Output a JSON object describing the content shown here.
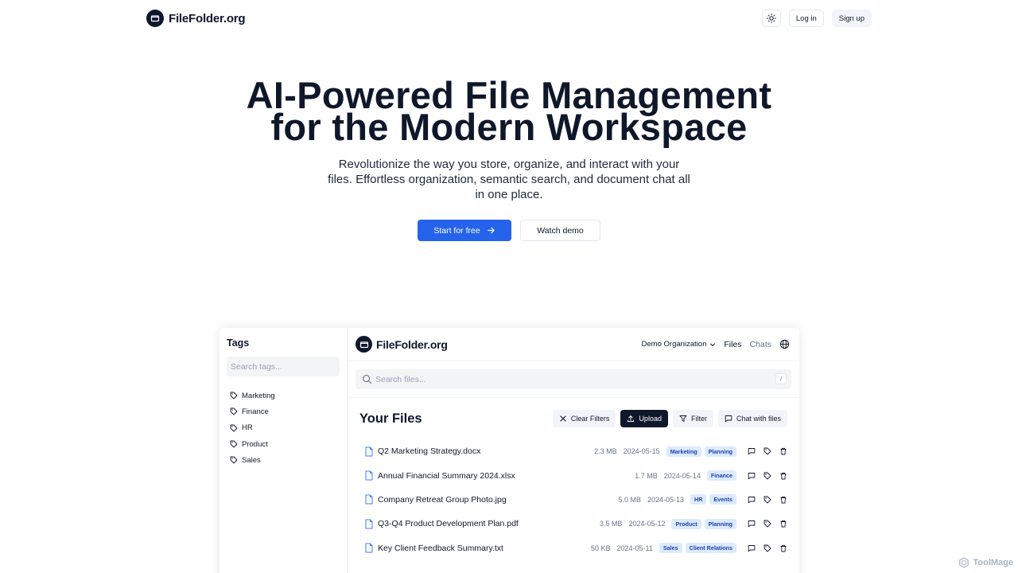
{
  "nav": {
    "brand": "FileFolder.org",
    "login": "Log in",
    "signup": "Sign up"
  },
  "hero": {
    "title_line1": "AI-Powered File Management",
    "title_line2": "for the Modern Workspace",
    "subtitle": "Revolutionize the way you store, organize, and interact with your files. Effortless organization, semantic search, and document chat all in one place.",
    "cta_primary": "Start for free",
    "cta_secondary": "Watch demo"
  },
  "demo": {
    "sidebar": {
      "title": "Tags",
      "search_placeholder": "Search tags...",
      "tags": [
        "Marketing",
        "Finance",
        "HR",
        "Product",
        "Sales"
      ]
    },
    "header": {
      "brand": "FileFolder.org",
      "org": "Demo Organization",
      "files_link": "Files",
      "chats_link": "Chats"
    },
    "search": {
      "placeholder": "Search files...",
      "shortcut": "/"
    },
    "files": {
      "title": "Your Files",
      "toolbar": {
        "clear_filters": "Clear Filters",
        "upload": "Upload",
        "filter": "Filter",
        "chat": "Chat with files"
      },
      "rows": [
        {
          "name": "Q2 Marketing Strategy.docx",
          "size": "2.3 MB",
          "date": "2024-05-15",
          "tags": [
            "Marketing",
            "Planning"
          ]
        },
        {
          "name": "Annual Financial Summary 2024.xlsx",
          "size": "1.7 MB",
          "date": "2024-05-14",
          "tags": [
            "Finance"
          ]
        },
        {
          "name": "Company Retreat Group Photo.jpg",
          "size": "5.0 MB",
          "date": "2024-05-13",
          "tags": [
            "HR",
            "Events"
          ]
        },
        {
          "name": "Q3-Q4 Product Development Plan.pdf",
          "size": "3.5 MB",
          "date": "2024-05-12",
          "tags": [
            "Product",
            "Planning"
          ]
        },
        {
          "name": "Key Client Feedback Summary.txt",
          "size": "50 KB",
          "date": "2024-05-11",
          "tags": [
            "Sales",
            "Client Relations"
          ]
        }
      ]
    }
  },
  "watermark": "ToolMage",
  "colors": {
    "primary": "#2563eb",
    "dark": "#0f172a",
    "badge_bg": "#dbeafe",
    "badge_text": "#1e40af"
  }
}
